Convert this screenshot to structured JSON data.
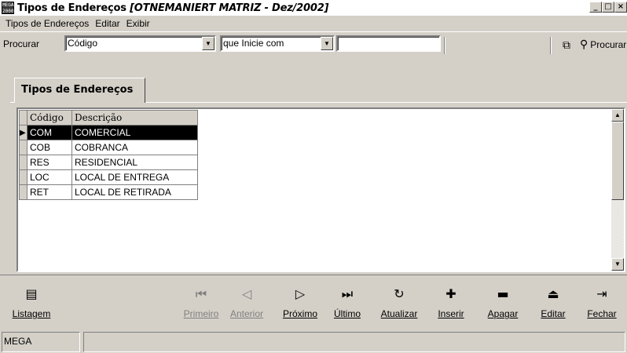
{
  "window": {
    "title": "Tipos de Endereços",
    "subtitle": "[OTNEMANIERT MATRIZ - Dez/2002]",
    "app_icon_text": "MEGA 2000",
    "min_label": "_",
    "max_label": "□",
    "close_label": "×"
  },
  "menu": [
    "Tipos de Endereços",
    "Editar",
    "Exibir"
  ],
  "search": {
    "label": "Procurar",
    "field_value": "Código",
    "mode_value": "que Inicie com",
    "text_value": "",
    "procurar_label": "Procurar"
  },
  "tab": {
    "label": "Tipos de Endereços"
  },
  "grid": {
    "columns": [
      "Código",
      "Descrição"
    ],
    "rows": [
      {
        "code": "COM",
        "desc": "COMERCIAL",
        "selected": true
      },
      {
        "code": "COB",
        "desc": "COBRANCA"
      },
      {
        "code": "RES",
        "desc": "RESIDENCIAL"
      },
      {
        "code": "LOC",
        "desc": "LOCAL DE ENTREGA"
      },
      {
        "code": "RET",
        "desc": "LOCAL DE RETIRADA"
      }
    ]
  },
  "nav": {
    "listagem": "Listagem",
    "primeiro": "Primeiro",
    "anterior": "Anterior",
    "proximo": "Próximo",
    "ultimo": "Último",
    "atualizar": "Atualizar",
    "inserir": "Inserir",
    "apagar": "Apagar",
    "editar": "Editar",
    "fechar": "Fechar"
  },
  "status": {
    "panel1": "MEGA",
    "panel2": ""
  }
}
